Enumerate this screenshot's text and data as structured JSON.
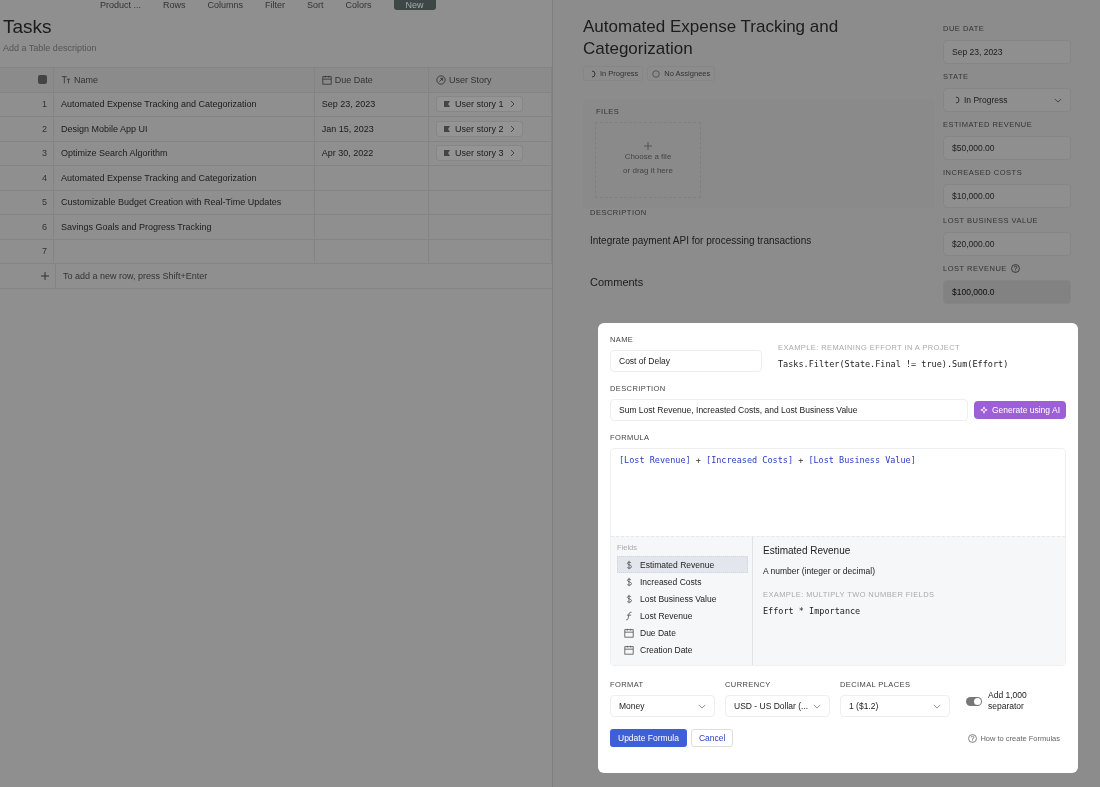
{
  "toolbar": {
    "items": [
      "Product ...",
      "Rows",
      "Columns",
      "Filter",
      "Sort",
      "Colors"
    ],
    "new_button": "New"
  },
  "table": {
    "title": "Tasks",
    "description_placeholder": "Add a Table description",
    "columns": [
      {
        "label": "Name",
        "kind": "text"
      },
      {
        "label": "Due Date",
        "kind": "date"
      },
      {
        "label": "User Story",
        "kind": "relation"
      }
    ],
    "rows": [
      {
        "number": "1",
        "name": "Automated Expense Tracking and Categorization",
        "due": "Sep 23, 2023",
        "story": "User story 1"
      },
      {
        "number": "2",
        "name": "Design Mobile App UI",
        "due": "Jan 15, 2023",
        "story": "User story 2"
      },
      {
        "number": "3",
        "name": "Optimize Search Algorithm",
        "due": "Apr 30, 2022",
        "story": "User story 3"
      },
      {
        "number": "4",
        "name": "Automated Expense Tracking and Categorization"
      },
      {
        "number": "5",
        "name": "Customizable Budget Creation with Real-Time Updates"
      },
      {
        "number": "6",
        "name": "Savings Goals and Progress Tracking"
      },
      {
        "number": "7"
      }
    ],
    "add_row_hint": "To add a new row, press Shift+Enter"
  },
  "detail": {
    "title": "Automated Expense Tracking and Categorization",
    "status": "In Progress",
    "assignees": "No Assignees",
    "files_label": "FILES",
    "dropzone": [
      "Choose a file",
      "or drag it here"
    ],
    "description_label": "DESCRIPTION",
    "description": "Integrate payment API for processing transactions",
    "comments_label": "Comments",
    "properties": [
      {
        "label": "DUE DATE",
        "value": "Sep 23, 2023",
        "kind": "text",
        "readonly": false,
        "help": false
      },
      {
        "label": "STATE",
        "value": "In Progress",
        "kind": "select",
        "readonly": false,
        "help": false
      },
      {
        "label": "ESTIMATED REVENUE",
        "value": "$50,000.00",
        "kind": "text",
        "readonly": false,
        "help": false
      },
      {
        "label": "INCREASED COSTS",
        "value": "$10,000.00",
        "kind": "text",
        "readonly": false,
        "help": false
      },
      {
        "label": "LOST BUSINESS VALUE",
        "value": "$20,000.00",
        "kind": "text",
        "readonly": false,
        "help": false
      },
      {
        "label": "LOST REVENUE",
        "value": "$100,000.0",
        "kind": "text",
        "readonly": true,
        "help": true
      }
    ]
  },
  "modal": {
    "name_label": "NAME",
    "name_value": "Cost of Delay",
    "example_label": "EXAMPLE: REMAINING EFFORT IN A PROJECT",
    "example_code": "Tasks.Filter(State.Final != true).Sum(Effort)",
    "description_label": "DESCRIPTION",
    "description_value": "Sum Lost Revenue, Increasted Costs, and Lost Business Value",
    "generate_button": "Generate using AI",
    "formula_label": "FORMULA",
    "formula": [
      {
        "text": "[Lost Revenue]",
        "kind": "ref"
      },
      {
        "text": " + ",
        "kind": "op"
      },
      {
        "text": "[Increased Costs]",
        "kind": "ref"
      },
      {
        "text": " + ",
        "kind": "op"
      },
      {
        "text": "[Lost Business Value]",
        "kind": "ref"
      }
    ],
    "fields_label": "Fields",
    "fields": [
      {
        "label": "Estimated Revenue",
        "kind": "money",
        "selected": true
      },
      {
        "label": "Increased Costs",
        "kind": "money",
        "selected": false
      },
      {
        "label": "Lost Business Value",
        "kind": "money",
        "selected": false
      },
      {
        "label": "Lost Revenue",
        "kind": "formula",
        "selected": false
      },
      {
        "label": "Due Date",
        "kind": "date",
        "selected": false
      },
      {
        "label": "Creation Date",
        "kind": "date",
        "selected": false
      }
    ],
    "help": {
      "title": "Estimated Revenue",
      "text": "A number (integer or decimal)",
      "example_label": "EXAMPLE: MULTIPLY TWO NUMBER FIELDS",
      "example_code": "Effort * Importance"
    },
    "selects": [
      {
        "label": "FORMAT",
        "value": "Money"
      },
      {
        "label": "CURRENCY",
        "value": "USD - US Dollar (..."
      },
      {
        "label": "DECIMAL PLACES",
        "value": "1 ($1.2)"
      }
    ],
    "separator_toggle": {
      "label": "Add 1,000 separator",
      "on": true
    },
    "update_button": "Update Formula",
    "cancel_button": "Cancel",
    "help_link": "How to create Formulas"
  }
}
